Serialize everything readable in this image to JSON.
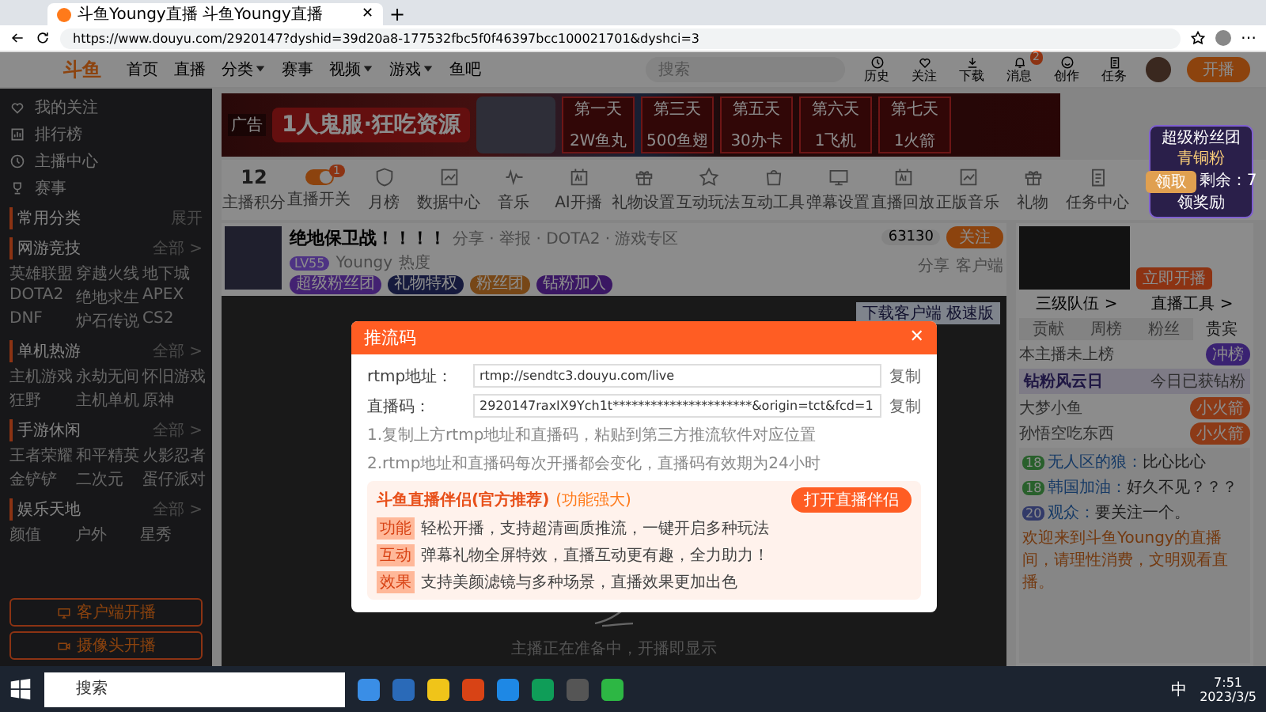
{
  "browser": {
    "tab_title": "斗鱼Youngy直播 斗鱼Youngy直播",
    "tab_close": "✕",
    "new_tab": "+",
    "menu": "⋯",
    "url": "https://www.douyu.com/2920147?dyshid=39d20a8-177532fbc5f0f46397bcc100021701&dyshci=3"
  },
  "header": {
    "logo": "斗鱼",
    "nav": [
      {
        "label": "首页",
        "dropdown": false
      },
      {
        "label": "直播",
        "dropdown": false
      },
      {
        "label": "分类",
        "dropdown": true
      },
      {
        "label": "赛事",
        "dropdown": false
      },
      {
        "label": "视频",
        "dropdown": true
      },
      {
        "label": "游戏",
        "dropdown": true
      },
      {
        "label": "鱼吧",
        "dropdown": false
      }
    ],
    "search_placeholder": "搜索",
    "icons": [
      {
        "kind": "clock",
        "label": "历史"
      },
      {
        "kind": "heart",
        "label": "关注"
      },
      {
        "kind": "download",
        "label": "下载"
      },
      {
        "kind": "bell",
        "label": "消息",
        "badge": "2"
      },
      {
        "kind": "face",
        "label": "创作"
      },
      {
        "kind": "task",
        "label": "任务"
      }
    ],
    "live_button": "开播"
  },
  "sidebar": {
    "links": [
      {
        "kind": "heart",
        "label": "我的关注"
      },
      {
        "kind": "rank",
        "label": "排行榜"
      },
      {
        "kind": "clock",
        "label": "主播中心"
      },
      {
        "kind": "trophy",
        "label": "赛事"
      }
    ],
    "sections": [
      {
        "title": "常用分类",
        "action": "展开"
      },
      {
        "title": "网游竞技",
        "action": "全部 >",
        "items": [
          "英雄联盟",
          "穿越火线",
          "地下城",
          "DOTA2",
          "绝地求生",
          "APEX",
          "DNF",
          "炉石传说",
          "CS2"
        ]
      },
      {
        "title": "单机热游",
        "action": "全部 >",
        "items": [
          "主机游戏",
          "永劫无间",
          "怀旧游戏",
          "狂野",
          "主机单机",
          "原神"
        ]
      },
      {
        "title": "手游休闲",
        "action": "全部 >",
        "items": [
          "王者荣耀",
          "和平精英",
          "火影忍者",
          "金铲铲",
          "二次元",
          "蛋仔派对"
        ]
      },
      {
        "title": "娱乐天地",
        "action": "全部 >",
        "items": [
          "颜值",
          "户外",
          "星秀"
        ]
      }
    ],
    "buttons": [
      {
        "kind": "monitor",
        "label": "客户端开播"
      },
      {
        "kind": "camera",
        "label": "摄像头开播"
      }
    ]
  },
  "banner": {
    "tag": "广告",
    "title": "1人鬼服·狂吃资源",
    "days": [
      {
        "day": "第一天",
        "reward": "2W鱼丸"
      },
      {
        "day": "第三天",
        "reward": "500鱼翅"
      },
      {
        "day": "第五天",
        "reward": "30办卡"
      },
      {
        "day": "第六天",
        "reward": "1飞机"
      },
      {
        "day": "第七天",
        "reward": "1火箭"
      }
    ]
  },
  "toolbar": {
    "points": {
      "value": "12",
      "label": "主播积分"
    },
    "items": [
      {
        "kind": "toggle",
        "label": "直播开关",
        "badge": "1"
      },
      {
        "kind": "shield",
        "label": "月榜"
      },
      {
        "kind": "chart",
        "label": "数据中心"
      },
      {
        "kind": "wave",
        "label": "音乐"
      },
      {
        "kind": "ai",
        "label": "AI开播"
      },
      {
        "kind": "gift",
        "label": "礼物设置"
      },
      {
        "kind": "star",
        "label": "互动玩法"
      },
      {
        "kind": "bag",
        "label": "互动工具"
      },
      {
        "kind": "screen",
        "label": "弹幕设置"
      },
      {
        "kind": "ai",
        "label": "直播回放"
      },
      {
        "kind": "chart",
        "label": "正版音乐"
      },
      {
        "kind": "gift",
        "label": "礼物"
      },
      {
        "kind": "task",
        "label": "任务中心"
      }
    ]
  },
  "streamer": {
    "title": "绝地保卫战！！！！",
    "meta": "分享 · 举报 · DOTA2 · 游戏专区",
    "level": "LV55",
    "name": "Youngy",
    "heat": "热度",
    "follows": "63130",
    "follow_button": "关注",
    "chips": [
      {
        "label": "超级粉丝团",
        "kind": "purple"
      },
      {
        "label": "礼物特权",
        "kind": "navy"
      },
      {
        "label": "粉丝团",
        "kind": "orange"
      },
      {
        "label": "钻粉加入",
        "kind": "violet"
      }
    ],
    "actions": [
      "分享",
      "客户端"
    ]
  },
  "video": {
    "badge": "下载客户端 极速版",
    "status": "主播正在准备中，开播即显示"
  },
  "right_panel": {
    "preview_button": "立即开播",
    "links": [
      "三级队伍 >",
      "直播工具 >"
    ],
    "tabs": [
      {
        "label": "贡献",
        "selected": false
      },
      {
        "label": "周榜",
        "selected": false
      },
      {
        "label": "粉丝",
        "selected": false
      },
      {
        "label": "贵宾",
        "selected": true
      }
    ],
    "rank_note": "本主播未上榜",
    "rank_button": "冲榜",
    "feature_title": "钻粉风云日",
    "feature_note": "今日已获钻粉",
    "users": [
      {
        "name": "大梦小鱼",
        "button": "小火箭"
      },
      {
        "name": "孙悟空吃东西",
        "button": "小火箭"
      }
    ],
    "messages": [
      {
        "level": "18",
        "kind": "fans",
        "name": "无人区的狼：",
        "text": "比心比心"
      },
      {
        "level": "18",
        "kind": "fans",
        "name": "韩国加油：",
        "text": "好久不见？？？"
      },
      {
        "level": "20",
        "kind": "noble",
        "name": "观众：",
        "text": "要关注一个。"
      }
    ],
    "notice": "欢迎来到斗鱼Youngy的直播间，请理性消费，文明观看直播。"
  },
  "fan_card": {
    "title": "超级粉丝团",
    "rank": "青铜粉",
    "button": "领取",
    "note": "剩余：7",
    "footer": "领奖励"
  },
  "modal": {
    "title": "推流码",
    "close": "✕",
    "fields": [
      {
        "label": "rtmp地址：",
        "value": "rtmp://sendtc3.douyu.com/live",
        "copy": "复制"
      },
      {
        "label": "直播码：",
        "value": "2920147raxIX9Ych1t**********************&origin=tct&fcd=1",
        "copy": "复制"
      }
    ],
    "tips": [
      "1.复制上方rtmp地址和直播码，粘贴到第三方推流软件对应位置",
      "2.rtmp地址和直播码每次开播都会变化，直播码有效期为24小时"
    ],
    "promo": {
      "title": "斗鱼直播伴侣(官方推荐)",
      "subtitle": "(功能强大)",
      "button": "打开直播伴侣",
      "rows": [
        {
          "tag": "功能",
          "text": "轻松开播，支持超清画质推流，一键开启多种玩法"
        },
        {
          "tag": "互动",
          "text": "弹幕礼物全屏特效，直播互动更有趣，全力助力！"
        },
        {
          "tag": "效果",
          "text": "支持美颜滤镜与多种场景，直播效果更加出色"
        }
      ]
    }
  },
  "taskbar": {
    "search": "搜索",
    "ime": "中",
    "time": "7:51",
    "date": "2023/3/5"
  }
}
